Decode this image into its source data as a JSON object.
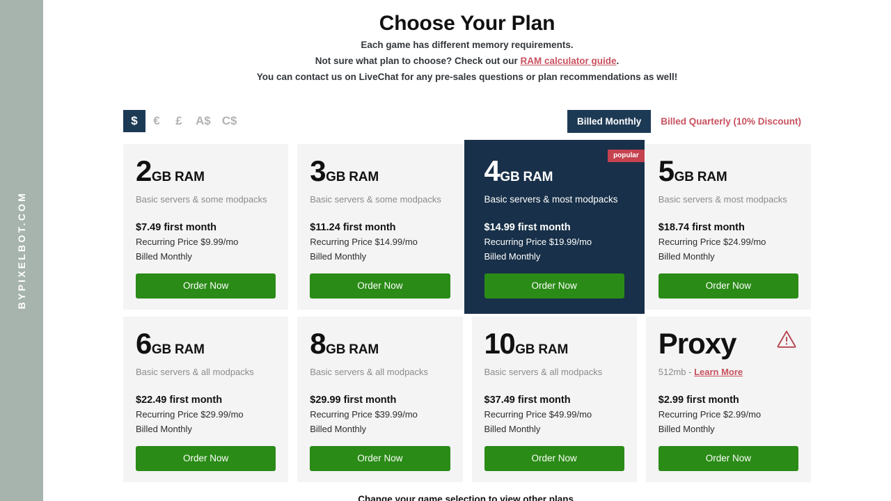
{
  "watermark": {
    "text": "BYPIXELBOT.COM"
  },
  "header": {
    "title": "Choose Your Plan",
    "line1": "Each game has different memory requirements.",
    "line2_before": "Not sure what plan to choose? Check out our ",
    "line2_link": "RAM calculator guide",
    "line2_after": ".",
    "line3": "You can contact us on LiveChat for any pre-sales questions or plan recommendations as well!"
  },
  "currency": {
    "options": [
      {
        "label": "$",
        "active": true
      },
      {
        "label": "€",
        "active": false
      },
      {
        "label": "£",
        "active": false
      },
      {
        "label": "A$",
        "active": false
      },
      {
        "label": "C$",
        "active": false
      }
    ]
  },
  "billing": {
    "monthly_label": "Billed Monthly",
    "quarterly_label": "Billed Quarterly (10% Discount)",
    "active": "Billed Monthly"
  },
  "colors": {
    "accent_navy": "#1d3a55",
    "featured_navy": "#183049",
    "order_green": "#2a8b16",
    "link_red": "#c8515f",
    "badge_red": "#c5424f",
    "watermark_bg": "#a7b4ad",
    "card_bg": "#f4f4f4"
  },
  "plans": [
    {
      "num": "2",
      "unit": "GB RAM",
      "desc": "Basic servers & some modpacks",
      "price_first": "$7.49 first month",
      "recurring": "Recurring Price $9.99/mo",
      "billing": "Billed Monthly",
      "cta": "Order Now",
      "featured": false,
      "badge": null,
      "warn": false
    },
    {
      "num": "3",
      "unit": "GB RAM",
      "desc": "Basic servers & some modpacks",
      "price_first": "$11.24 first month",
      "recurring": "Recurring Price $14.99/mo",
      "billing": "Billed Monthly",
      "cta": "Order Now",
      "featured": false,
      "badge": null,
      "warn": false
    },
    {
      "num": "4",
      "unit": "GB RAM",
      "desc": "Basic servers & most modpacks",
      "price_first": "$14.99 first month",
      "recurring": "Recurring Price $19.99/mo",
      "billing": "Billed Monthly",
      "cta": "Order Now",
      "featured": true,
      "badge": "popular",
      "warn": false
    },
    {
      "num": "5",
      "unit": "GB RAM",
      "desc": "Basic servers & most modpacks",
      "price_first": "$18.74 first month",
      "recurring": "Recurring Price $24.99/mo",
      "billing": "Billed Monthly",
      "cta": "Order Now",
      "featured": false,
      "badge": null,
      "warn": false
    },
    {
      "num": "6",
      "unit": "GB RAM",
      "desc": "Basic servers & all modpacks",
      "price_first": "$22.49 first month",
      "recurring": "Recurring Price $29.99/mo",
      "billing": "Billed Monthly",
      "cta": "Order Now",
      "featured": false,
      "badge": null,
      "warn": false
    },
    {
      "num": "8",
      "unit": "GB RAM",
      "desc": "Basic servers & all modpacks",
      "price_first": "$29.99 first month",
      "recurring": "Recurring Price $39.99/mo",
      "billing": "Billed Monthly",
      "cta": "Order Now",
      "featured": false,
      "badge": null,
      "warn": false
    },
    {
      "num": "10",
      "unit": "GB RAM",
      "desc": "Basic servers & all modpacks",
      "price_first": "$37.49 first month",
      "recurring": "Recurring Price $49.99/mo",
      "billing": "Billed Monthly",
      "cta": "Order Now",
      "featured": false,
      "badge": null,
      "warn": false
    },
    {
      "word": "Proxy",
      "num": null,
      "unit": null,
      "desc_prefix": "512mb - ",
      "desc_link": "Learn More",
      "price_first": "$2.99 first month",
      "recurring": "Recurring Price $2.99/mo",
      "billing": "Billed Monthly",
      "cta": "Order Now",
      "featured": false,
      "badge": null,
      "warn": true
    }
  ],
  "footer": {
    "note": "Change your game selection to view other plans."
  }
}
